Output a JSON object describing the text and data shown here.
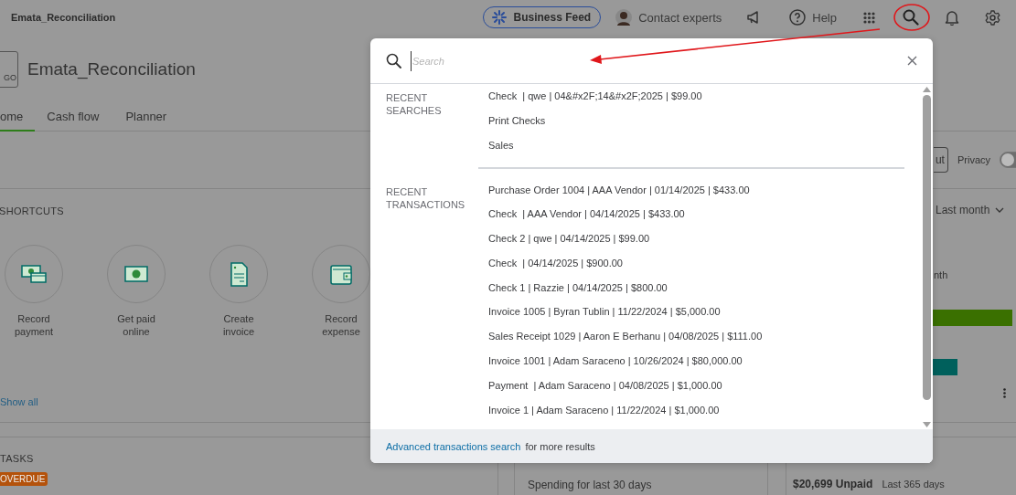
{
  "top_bar": {
    "company": "Emata_Reconciliation",
    "business_feed": "Business Feed",
    "contact_experts": "Contact experts",
    "help": "Help"
  },
  "header": {
    "logo_text": "GO",
    "title": "Emata_Reconciliation"
  },
  "tabs": [
    {
      "label": "ome",
      "selected": true
    },
    {
      "label": "Cash flow",
      "selected": false
    },
    {
      "label": "Planner",
      "selected": false
    }
  ],
  "shortcuts": {
    "title": "SHORTCUTS",
    "items": [
      {
        "label": "Record payment",
        "kind": "payment"
      },
      {
        "label": "Get paid online",
        "kind": "bill"
      },
      {
        "label": "Create invoice",
        "kind": "invoice"
      },
      {
        "label": "Record expense",
        "kind": "wallet"
      }
    ],
    "show_all": "Show all"
  },
  "right_panel": {
    "button": "ut",
    "privacy": {
      "label": "Privacy",
      "on": false
    },
    "period": "Last month",
    "caption": "nth",
    "bars": [
      {
        "color": "#3a7000"
      },
      {
        "color": "#00605c"
      }
    ]
  },
  "tasks": {
    "title": "TASKS",
    "badge": "OVERDUE"
  },
  "spending": {
    "text": "Spending for last 30 days"
  },
  "invoices": {
    "amount": "$20,699 Unpaid",
    "period": "Last 365 days"
  },
  "search_dialog": {
    "placeholder": "Search",
    "sections": [
      {
        "title": "RECENT SEARCHES",
        "items": [
          "Check  | qwe | 04&#x2F;14&#x2F;2025 | $99.00",
          "Print Checks",
          "Sales"
        ]
      },
      {
        "title": "RECENT TRANSACTIONS",
        "items": [
          "Purchase Order 1004 | AAA Vendor | 01/14/2025 | $433.00",
          "Check  | AAA Vendor | 04/14/2025 | $433.00",
          "Check 2 | qwe | 04/14/2025 | $99.00",
          "Check  | 04/14/2025 | $900.00",
          "Check 1 | Razzie | 04/14/2025 | $800.00",
          "Invoice 1005 | Byran Tublin | 11/22/2024 | $5,000.00",
          "Sales Receipt 1029 | Aaron E Berhanu | 04/08/2025 | $111.00",
          "Invoice 1001 | Adam Saraceno | 10/26/2024 | $80,000.00",
          "Payment  | Adam Saraceno | 04/08/2025 | $1,000.00",
          "Invoice 1 | Adam Saraceno | 11/22/2024 | $1,000.00"
        ]
      }
    ],
    "footer_link": "Advanced transactions search",
    "footer_text": "for more results"
  }
}
